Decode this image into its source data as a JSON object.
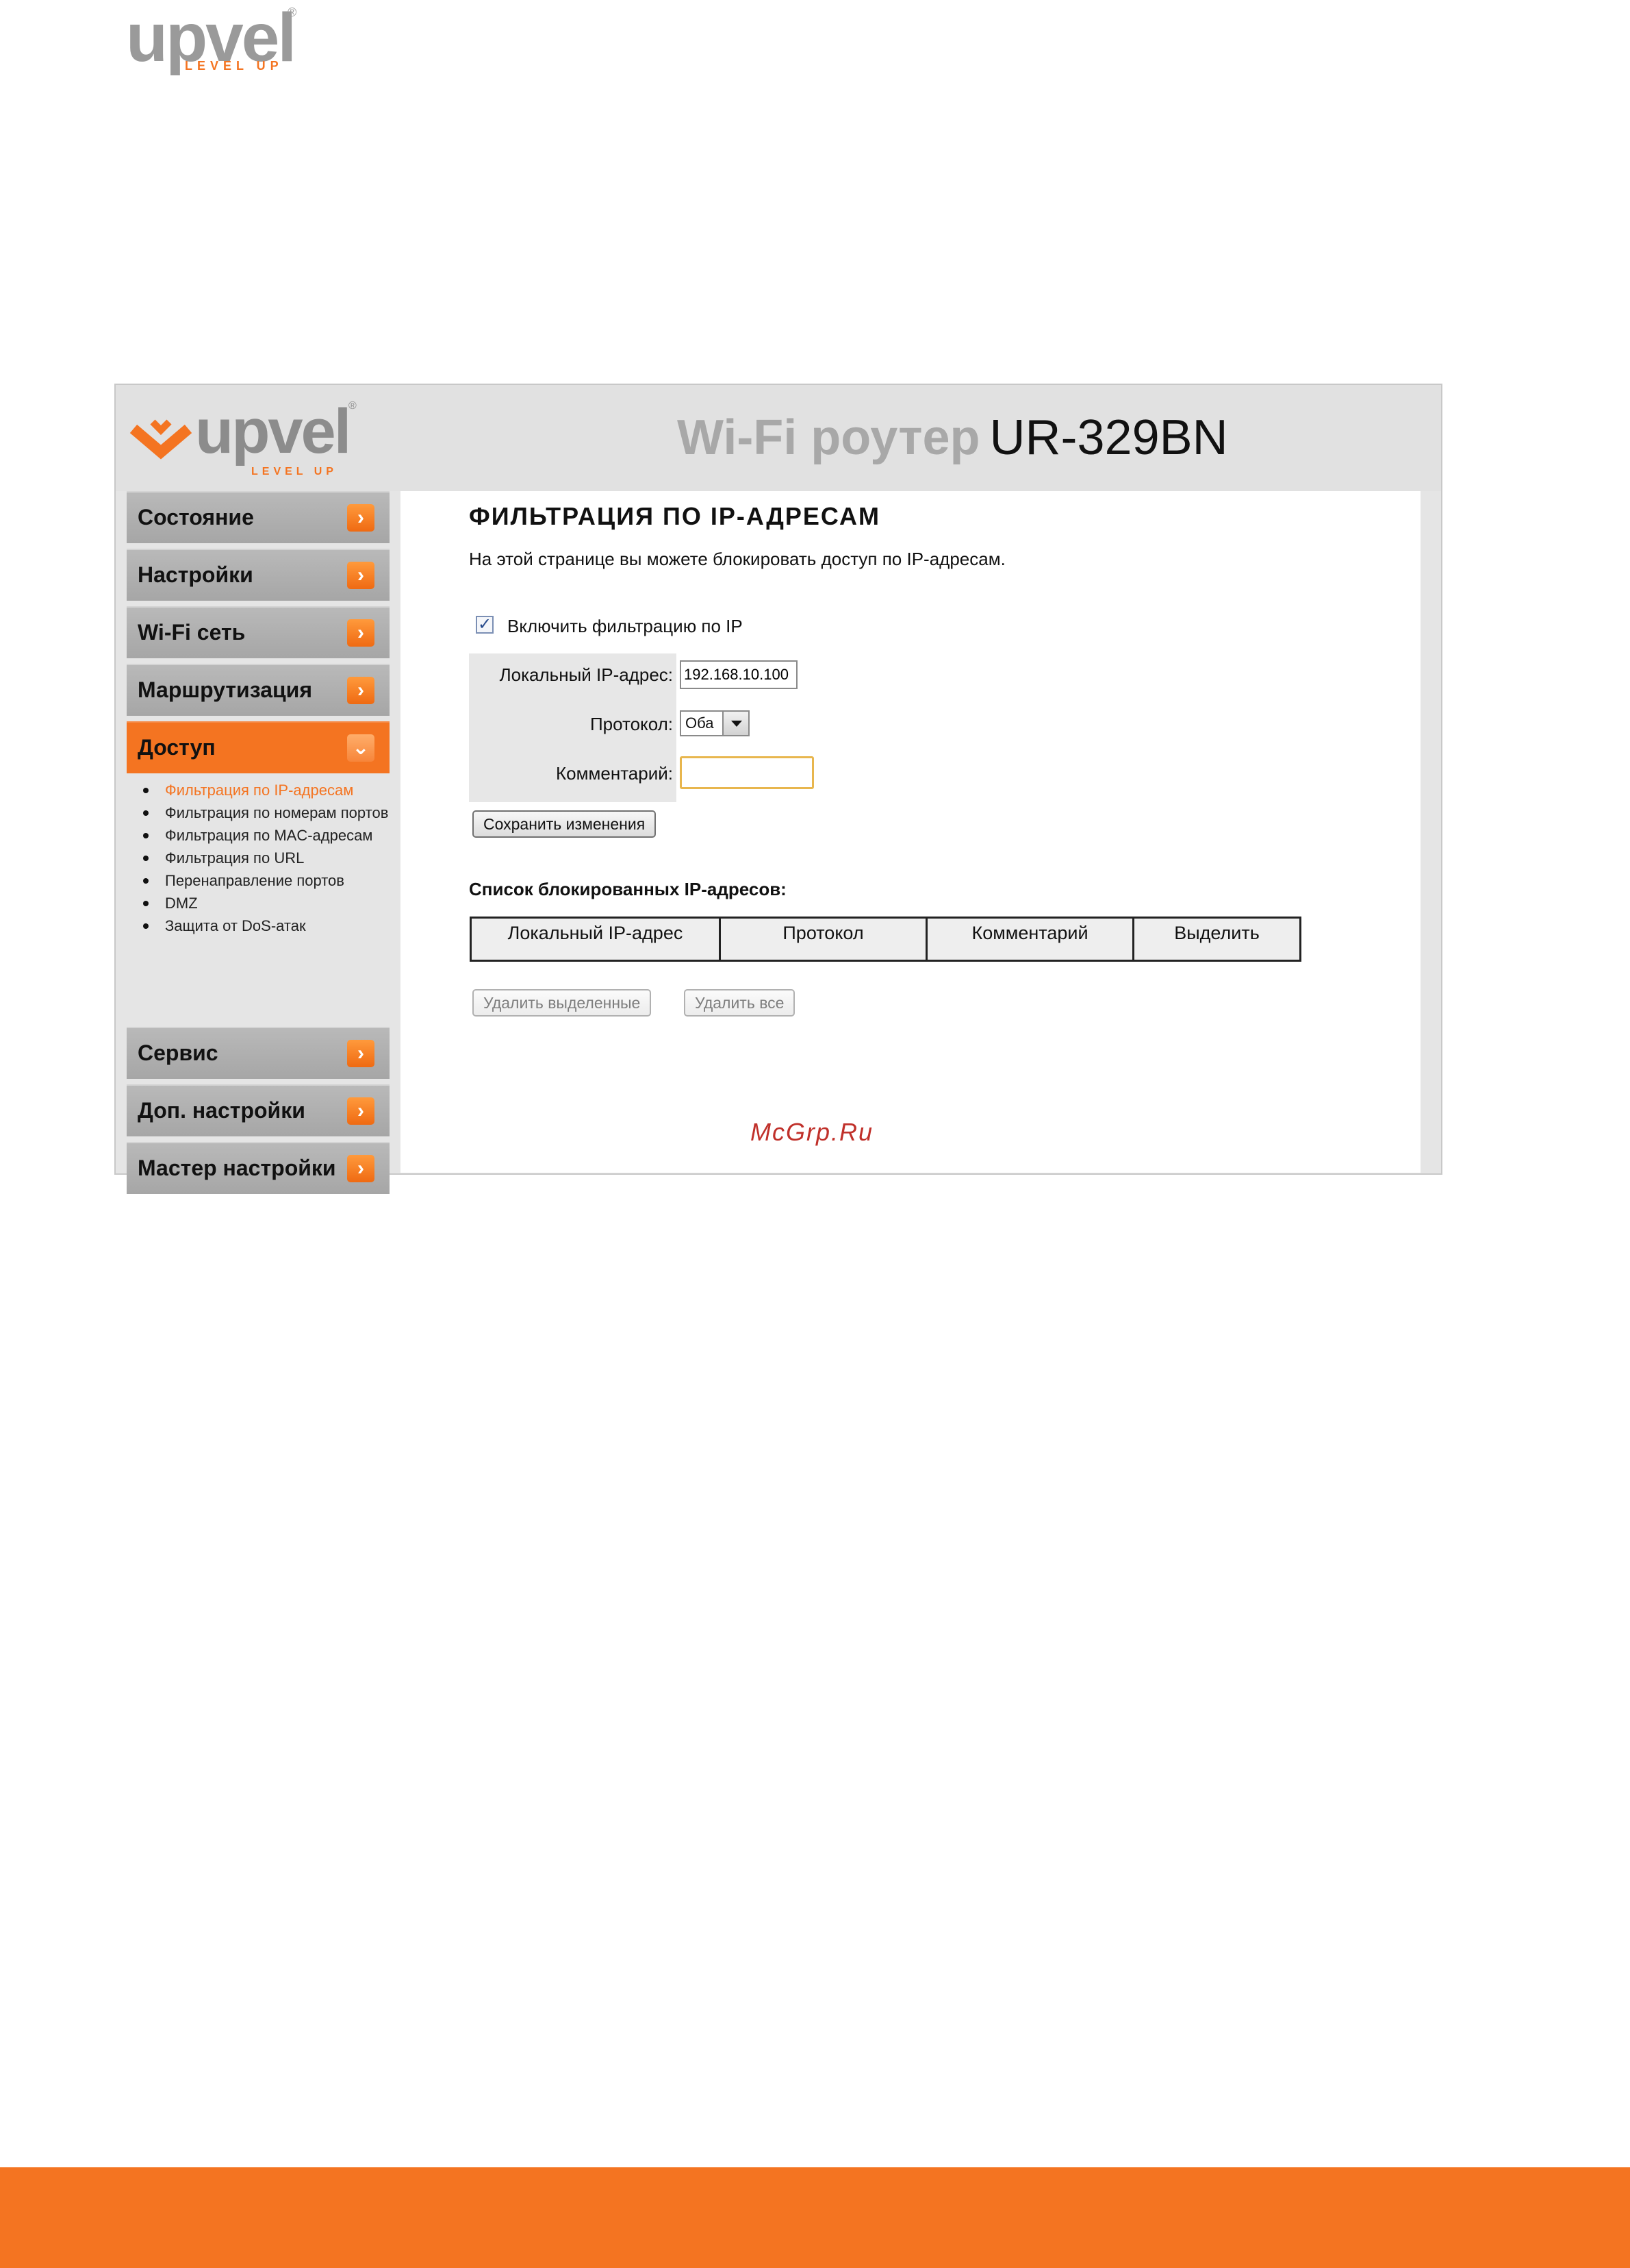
{
  "brand": {
    "name": "upvel",
    "tagline": "LEVEL UP",
    "registered": "®"
  },
  "header": {
    "title_prefix": "Wi-Fi роутер",
    "model": "UR-329BN"
  },
  "sidebar": {
    "items": [
      {
        "label": "Состояние",
        "arrow": "›"
      },
      {
        "label": "Настройки",
        "arrow": "›"
      },
      {
        "label": "Wi-Fi сеть",
        "arrow": "›"
      },
      {
        "label": "Маршрутизация",
        "arrow": "›"
      },
      {
        "label": "Доступ",
        "arrow": "⌄"
      },
      {
        "label": "Сервис",
        "arrow": "›"
      },
      {
        "label": "Доп. настройки",
        "arrow": "›"
      },
      {
        "label": "Мастер настройки",
        "arrow": "›"
      }
    ],
    "submenu": [
      "Фильтрация по IP-адресам",
      "Фильтрация по номерам портов",
      "Фильтрация по MAC-адресам",
      "Фильтрация по URL",
      "Перенаправление портов",
      "DMZ",
      "Защита от DoS-атак"
    ]
  },
  "main": {
    "title": "ФИЛЬТРАЦИЯ ПО IP-АДРЕСАМ",
    "description": "На этой странице вы можете блокировать доступ по IP-адресам.",
    "enable_label": "Включить фильтрацию по IP",
    "enable_checked": "✓",
    "fields": {
      "local_ip_label": "Локальный IP-адрес:",
      "local_ip_value": "192.168.10.100",
      "protocol_label": "Протокол:",
      "protocol_value": "Оба",
      "comment_label": "Комментарий:"
    },
    "save_button": "Сохранить изменения",
    "list_title": "Список блокированных IP-адресов:",
    "table_headers": [
      "Локальный IP-адрес",
      "Протокол",
      "Комментарий",
      "Выделить"
    ],
    "delete_selected_button": "Удалить выделенные",
    "delete_all_button": "Удалить все"
  },
  "watermark": "McGrp.Ru",
  "colors": {
    "accent": "#f47421",
    "sidebar": "#b0b0b0",
    "header": "#e1e1e1"
  }
}
